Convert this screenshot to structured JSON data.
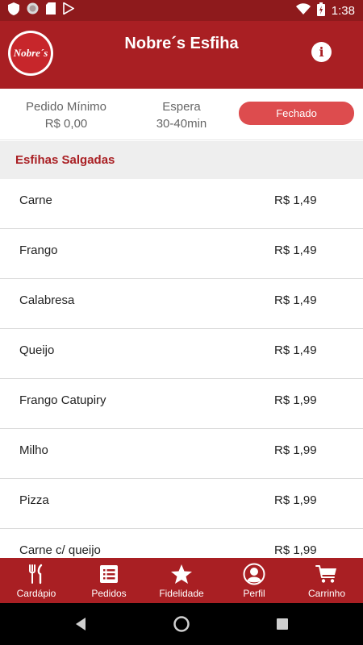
{
  "status_bar": {
    "time": "1:38",
    "icons": [
      "shield-icon",
      "record-icon",
      "sd-card-icon",
      "play-store-icon",
      "wifi-icon",
      "battery-charging-icon"
    ]
  },
  "header": {
    "title": "Nobre´s Esfiha",
    "logo_text": "Nobre´s",
    "info_label": "i"
  },
  "info": {
    "min_order_label": "Pedido Mínimo",
    "min_order_value": "R$ 0,00",
    "wait_label": "Espera",
    "wait_value": "30-40min",
    "status": "Fechado"
  },
  "section": {
    "title": "Esfihas Salgadas"
  },
  "items": [
    {
      "name": "Carne",
      "price": "R$ 1,49"
    },
    {
      "name": "Frango",
      "price": "R$ 1,49"
    },
    {
      "name": "Calabresa",
      "price": "R$ 1,49"
    },
    {
      "name": "Queijo",
      "price": "R$ 1,49"
    },
    {
      "name": "Frango Catupiry",
      "price": "R$ 1,99"
    },
    {
      "name": "Milho",
      "price": "R$ 1,99"
    },
    {
      "name": "Pizza",
      "price": "R$ 1,99"
    },
    {
      "name": "Carne c/ queijo",
      "price": "R$ 1,99"
    }
  ],
  "tabs": [
    {
      "label": "Cardápio",
      "icon": "cutlery-icon"
    },
    {
      "label": "Pedidos",
      "icon": "list-icon"
    },
    {
      "label": "Fidelidade",
      "icon": "star-icon"
    },
    {
      "label": "Perfil",
      "icon": "user-icon"
    },
    {
      "label": "Carrinho",
      "icon": "cart-icon"
    }
  ],
  "colors": {
    "primary": "#a91f23",
    "status_bar": "#8e1a1c",
    "closed_pill": "#dd4c4e",
    "section_bg": "#eeeeee"
  }
}
